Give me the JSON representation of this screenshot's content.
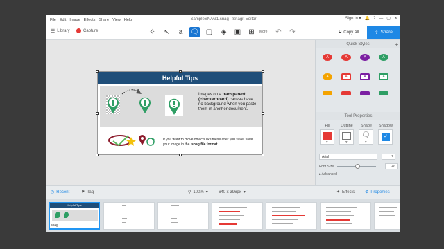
{
  "menu": {
    "items": [
      "File",
      "Edit",
      "Image",
      "Effects",
      "Share",
      "View",
      "Help"
    ],
    "title": "SampleSNAG1.snag - Snagit Editor",
    "sign_in": "Sign in ▾",
    "minimize": "—",
    "maximize": "▢",
    "close": "✕"
  },
  "toolbar": {
    "library": "Library",
    "capture": "Capture",
    "more": "More",
    "copy_all": "Copy All",
    "share": "Share"
  },
  "image": {
    "title": "Helpful Tips",
    "desc_pre": "Images on a ",
    "desc_bold": "transparent (checkerboard)",
    "desc_post": " canvas have no background when you paste them in another document.",
    "bottom_pre": "If you want to move objects like these after you save, save your image in the ",
    "bottom_bold": ".snag file format",
    "bottom_post": "."
  },
  "sidebar": {
    "quick_styles": "Quick Styles",
    "tool_properties": "Tool Properties",
    "fill": "Fill",
    "outline": "Outline",
    "shape": "Shape",
    "shadow": "Shadow",
    "font": "Arial",
    "font_size_label": "Font Size",
    "font_size": "46",
    "advanced": "Advanced"
  },
  "bottom": {
    "recent": "Recent",
    "tag": "Tag",
    "zoom": "100%",
    "size": "640 x 396px",
    "effects": "Effects",
    "properties": "Properties"
  },
  "tray": {
    "first_label": "snag",
    "thumb_title": "Helpful Tips"
  },
  "colors": {
    "accent": "#1e88e5",
    "title_bar": "#1f4e79",
    "pin": "#2e9e64",
    "red": "#e53935"
  }
}
